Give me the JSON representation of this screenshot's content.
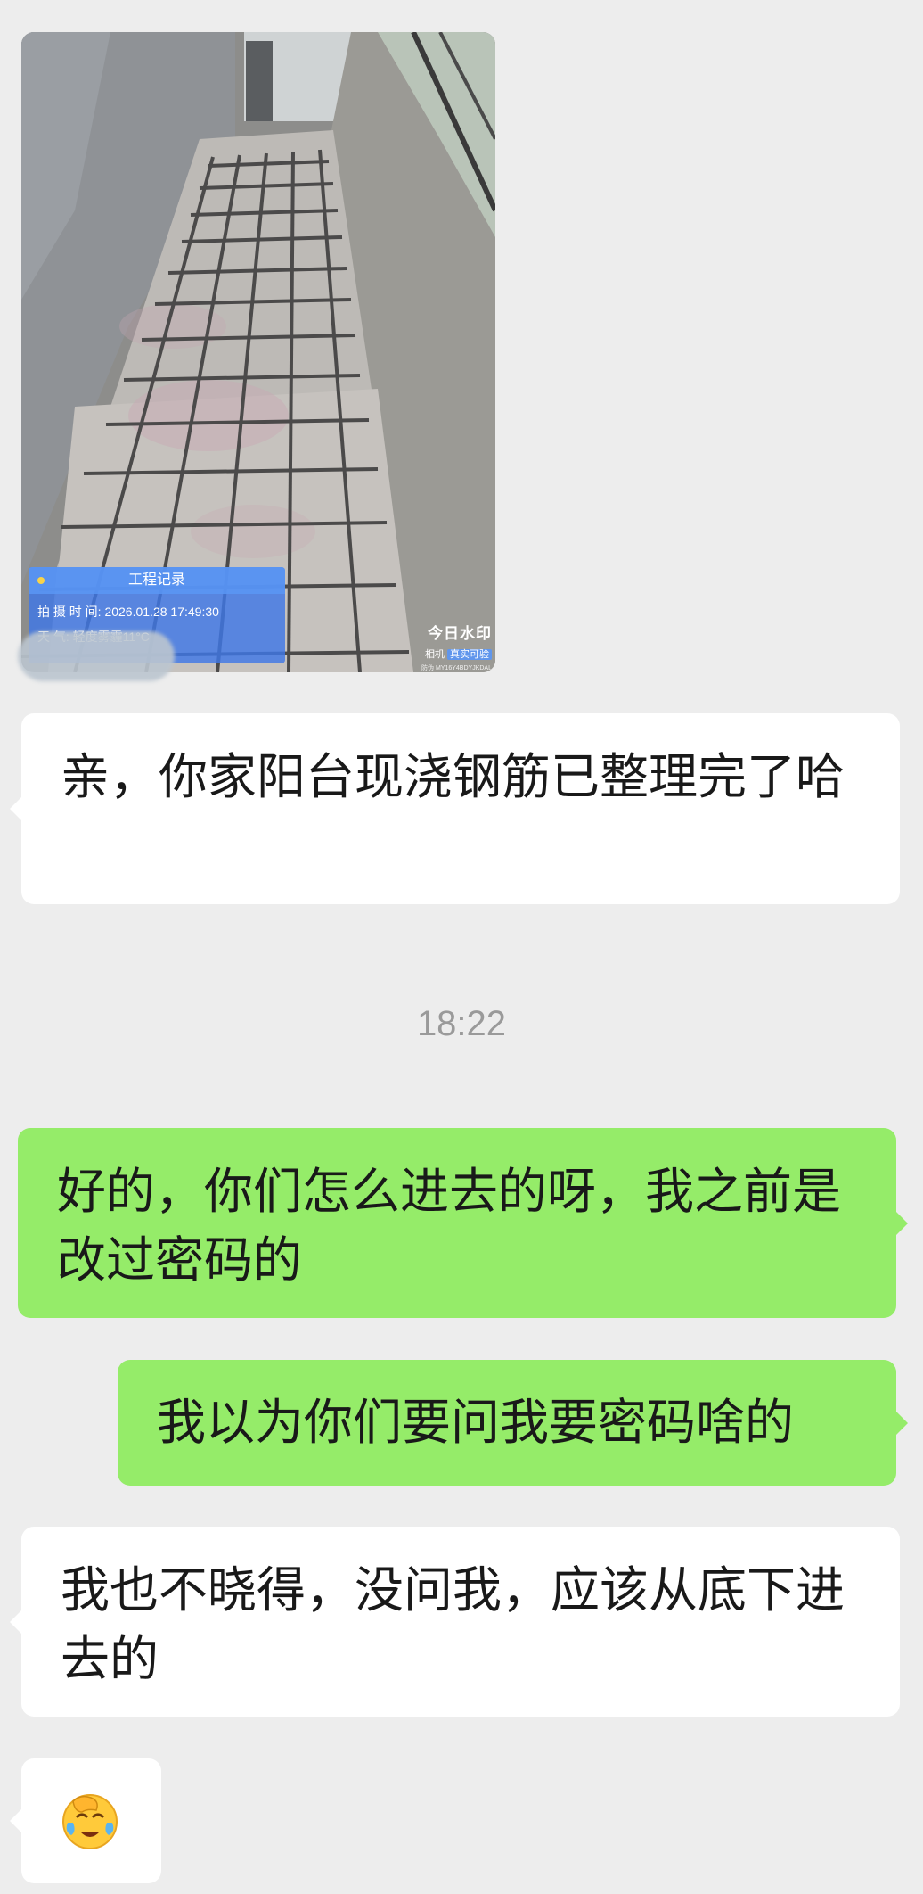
{
  "photo": {
    "watermark_title": "工程记录",
    "shot_time": "拍 摄 时 间: 2026.01.28 17:49:30",
    "weather": "天      气: 轻度雾霾11°C",
    "brand_main": "今日水印",
    "brand_camera": "相机",
    "brand_tag": "真实可验",
    "brand_code": "防伪 MY16Y4BDYJKDAL"
  },
  "messages": [
    {
      "side": "left",
      "text": "亲，你家阳台现浇钢筋已整理完了哈"
    },
    {
      "side": "right",
      "text": "好的，你们怎么进去的呀，我之前是改过密码的"
    },
    {
      "side": "right",
      "text": "我以为你们要问我要密码啥的"
    },
    {
      "side": "left",
      "text": "我也不晓得，没问我，应该从底下进去的"
    },
    {
      "side": "left",
      "emoji": "face-palm-crying-emoji"
    }
  ],
  "timestamp": "18:22"
}
